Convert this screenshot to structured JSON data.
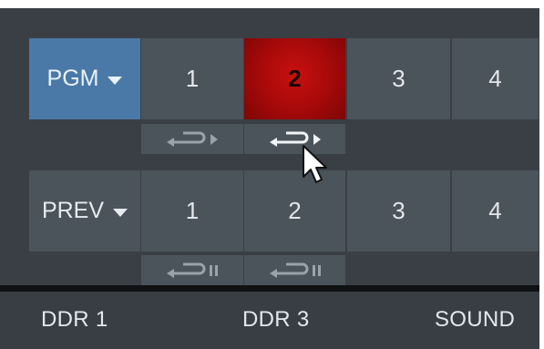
{
  "program_row": {
    "label": "PGM",
    "buttons": [
      "1",
      "2",
      "3",
      "4"
    ],
    "active": "2"
  },
  "preview_row": {
    "label": "PREV",
    "buttons": [
      "1",
      "2",
      "3",
      "4"
    ]
  },
  "tabs": [
    "DDR 1",
    "DDR 3",
    "SOUND"
  ],
  "colors": {
    "pgm_label": "#4a79a8",
    "active_tally": "#b30d0d",
    "button": "#4b535b",
    "panel": "#3a3f45"
  },
  "icons": {
    "loop_play": "loop-play-icon",
    "loop_pause": "loop-pause-icon",
    "cursor": "mouse-pointer-icon"
  }
}
